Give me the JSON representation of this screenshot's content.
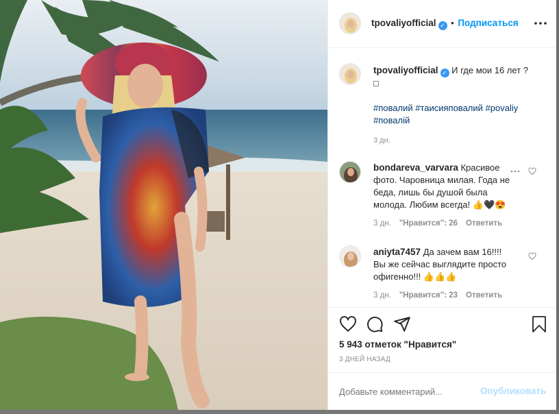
{
  "post": {
    "username": "tpovaliyofficial",
    "follow_label": "Подписаться",
    "verified_mark": "✓",
    "more_icon": "more-horizontal-icon",
    "caption_text": "И где мои 16 лет ?",
    "caption_emoji": "□",
    "hashtags_line1": "#повалий #таисияповалий #povaliy",
    "hashtags_line2": "#повалій",
    "caption_time": "3 дн."
  },
  "comments": [
    {
      "username": "bondareva_varvara",
      "text_l1": "Красивое",
      "text_l2": "фото. Чаровница милая. Года не",
      "text_l3": "беда, лишь бы душой была",
      "text_l4": "молода. Любим всегда! 👍🖤😍",
      "time": "3 дн.",
      "likes": "\"Нравится\": 26",
      "reply": "Ответить"
    },
    {
      "username": "aniyta7457",
      "text_l1": "Да зачем вам 16!!!!",
      "text_l2": "Вы же сейчас выглядите просто",
      "text_l3": "офигенно!!! 👍👍👍",
      "time": "3 дн.",
      "likes": "\"Нравится\": 23",
      "reply": "Ответить"
    }
  ],
  "actions": {
    "like_icon": "heart-icon",
    "comment_icon": "comment-icon",
    "share_icon": "share-icon",
    "save_icon": "bookmark-icon"
  },
  "stats": {
    "likes_label": "5 943 отметок \"Нравится\"",
    "posted_ago": "3 ДНЕЙ НАЗАД"
  },
  "comment_box": {
    "placeholder": "Добавьте комментарий...",
    "publish_label": "Опубликовать"
  },
  "colors": {
    "accent": "#0095f6",
    "publish_disabled": "#b2dffc",
    "verified": "#3897f0"
  }
}
